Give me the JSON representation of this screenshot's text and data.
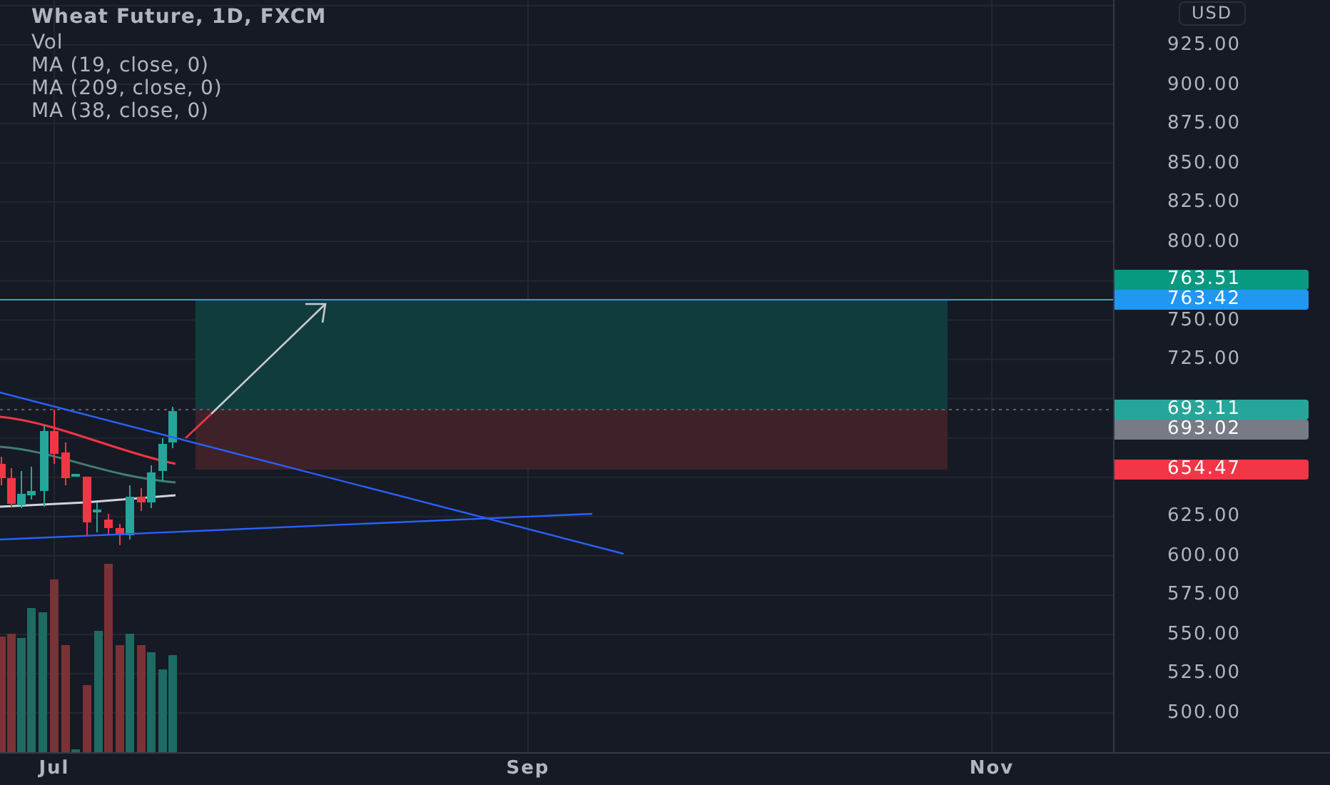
{
  "legend": {
    "title": "Wheat Future, 1D, FXCM",
    "indicators": [
      "Vol",
      "MA (19, close, 0)",
      "MA (209, close, 0)",
      "MA (38, close, 0)"
    ]
  },
  "price_axis": {
    "currency": "USD",
    "labels": [
      "925.00",
      "900.00",
      "875.00",
      "850.00",
      "825.00",
      "800.00",
      "750.00",
      "725.00",
      "625.00",
      "600.00",
      "575.00",
      "550.00",
      "525.00",
      "500.00"
    ]
  },
  "price_tags": [
    {
      "value": "763.51",
      "color": "#089981"
    },
    {
      "value": "763.42",
      "color": "#2196f3"
    },
    {
      "value": "693.11",
      "color": "#26a69a"
    },
    {
      "value": "693.02",
      "color": "#787b86"
    },
    {
      "value": "654.47",
      "color": "#f23645"
    }
  ],
  "time_axis": {
    "labels": [
      "Jul",
      "Sep",
      "Nov"
    ]
  }
}
